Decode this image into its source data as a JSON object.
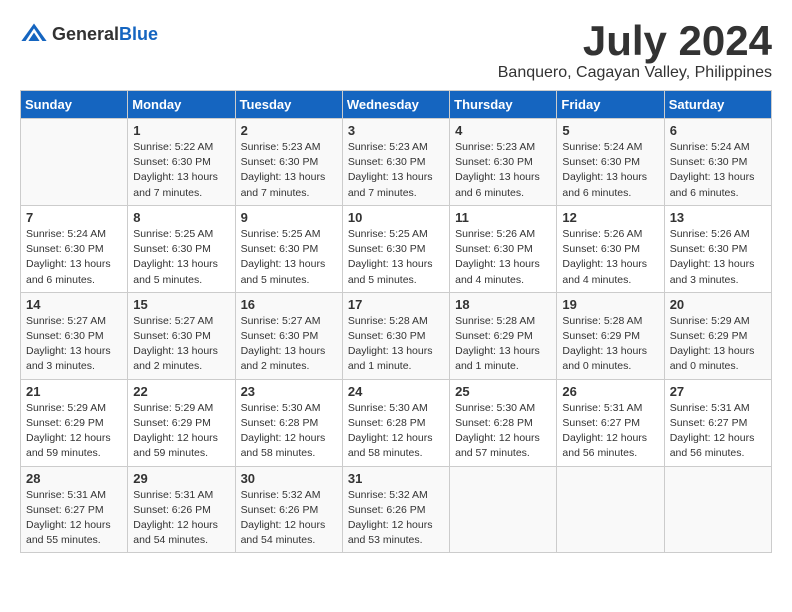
{
  "logo": {
    "general": "General",
    "blue": "Blue"
  },
  "title": "July 2024",
  "location": "Banquero, Cagayan Valley, Philippines",
  "headers": [
    "Sunday",
    "Monday",
    "Tuesday",
    "Wednesday",
    "Thursday",
    "Friday",
    "Saturday"
  ],
  "weeks": [
    [
      {
        "day": "",
        "detail": ""
      },
      {
        "day": "1",
        "detail": "Sunrise: 5:22 AM\nSunset: 6:30 PM\nDaylight: 13 hours\nand 7 minutes."
      },
      {
        "day": "2",
        "detail": "Sunrise: 5:23 AM\nSunset: 6:30 PM\nDaylight: 13 hours\nand 7 minutes."
      },
      {
        "day": "3",
        "detail": "Sunrise: 5:23 AM\nSunset: 6:30 PM\nDaylight: 13 hours\nand 7 minutes."
      },
      {
        "day": "4",
        "detail": "Sunrise: 5:23 AM\nSunset: 6:30 PM\nDaylight: 13 hours\nand 6 minutes."
      },
      {
        "day": "5",
        "detail": "Sunrise: 5:24 AM\nSunset: 6:30 PM\nDaylight: 13 hours\nand 6 minutes."
      },
      {
        "day": "6",
        "detail": "Sunrise: 5:24 AM\nSunset: 6:30 PM\nDaylight: 13 hours\nand 6 minutes."
      }
    ],
    [
      {
        "day": "7",
        "detail": "Sunrise: 5:24 AM\nSunset: 6:30 PM\nDaylight: 13 hours\nand 6 minutes."
      },
      {
        "day": "8",
        "detail": "Sunrise: 5:25 AM\nSunset: 6:30 PM\nDaylight: 13 hours\nand 5 minutes."
      },
      {
        "day": "9",
        "detail": "Sunrise: 5:25 AM\nSunset: 6:30 PM\nDaylight: 13 hours\nand 5 minutes."
      },
      {
        "day": "10",
        "detail": "Sunrise: 5:25 AM\nSunset: 6:30 PM\nDaylight: 13 hours\nand 5 minutes."
      },
      {
        "day": "11",
        "detail": "Sunrise: 5:26 AM\nSunset: 6:30 PM\nDaylight: 13 hours\nand 4 minutes."
      },
      {
        "day": "12",
        "detail": "Sunrise: 5:26 AM\nSunset: 6:30 PM\nDaylight: 13 hours\nand 4 minutes."
      },
      {
        "day": "13",
        "detail": "Sunrise: 5:26 AM\nSunset: 6:30 PM\nDaylight: 13 hours\nand 3 minutes."
      }
    ],
    [
      {
        "day": "14",
        "detail": "Sunrise: 5:27 AM\nSunset: 6:30 PM\nDaylight: 13 hours\nand 3 minutes."
      },
      {
        "day": "15",
        "detail": "Sunrise: 5:27 AM\nSunset: 6:30 PM\nDaylight: 13 hours\nand 2 minutes."
      },
      {
        "day": "16",
        "detail": "Sunrise: 5:27 AM\nSunset: 6:30 PM\nDaylight: 13 hours\nand 2 minutes."
      },
      {
        "day": "17",
        "detail": "Sunrise: 5:28 AM\nSunset: 6:30 PM\nDaylight: 13 hours\nand 1 minute."
      },
      {
        "day": "18",
        "detail": "Sunrise: 5:28 AM\nSunset: 6:29 PM\nDaylight: 13 hours\nand 1 minute."
      },
      {
        "day": "19",
        "detail": "Sunrise: 5:28 AM\nSunset: 6:29 PM\nDaylight: 13 hours\nand 0 minutes."
      },
      {
        "day": "20",
        "detail": "Sunrise: 5:29 AM\nSunset: 6:29 PM\nDaylight: 13 hours\nand 0 minutes."
      }
    ],
    [
      {
        "day": "21",
        "detail": "Sunrise: 5:29 AM\nSunset: 6:29 PM\nDaylight: 12 hours\nand 59 minutes."
      },
      {
        "day": "22",
        "detail": "Sunrise: 5:29 AM\nSunset: 6:29 PM\nDaylight: 12 hours\nand 59 minutes."
      },
      {
        "day": "23",
        "detail": "Sunrise: 5:30 AM\nSunset: 6:28 PM\nDaylight: 12 hours\nand 58 minutes."
      },
      {
        "day": "24",
        "detail": "Sunrise: 5:30 AM\nSunset: 6:28 PM\nDaylight: 12 hours\nand 58 minutes."
      },
      {
        "day": "25",
        "detail": "Sunrise: 5:30 AM\nSunset: 6:28 PM\nDaylight: 12 hours\nand 57 minutes."
      },
      {
        "day": "26",
        "detail": "Sunrise: 5:31 AM\nSunset: 6:27 PM\nDaylight: 12 hours\nand 56 minutes."
      },
      {
        "day": "27",
        "detail": "Sunrise: 5:31 AM\nSunset: 6:27 PM\nDaylight: 12 hours\nand 56 minutes."
      }
    ],
    [
      {
        "day": "28",
        "detail": "Sunrise: 5:31 AM\nSunset: 6:27 PM\nDaylight: 12 hours\nand 55 minutes."
      },
      {
        "day": "29",
        "detail": "Sunrise: 5:31 AM\nSunset: 6:26 PM\nDaylight: 12 hours\nand 54 minutes."
      },
      {
        "day": "30",
        "detail": "Sunrise: 5:32 AM\nSunset: 6:26 PM\nDaylight: 12 hours\nand 54 minutes."
      },
      {
        "day": "31",
        "detail": "Sunrise: 5:32 AM\nSunset: 6:26 PM\nDaylight: 12 hours\nand 53 minutes."
      },
      {
        "day": "",
        "detail": ""
      },
      {
        "day": "",
        "detail": ""
      },
      {
        "day": "",
        "detail": ""
      }
    ]
  ]
}
